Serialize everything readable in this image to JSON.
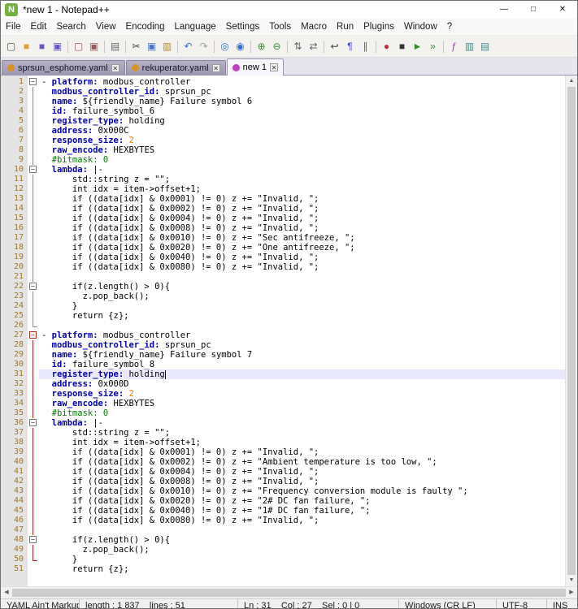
{
  "window": {
    "title": "*new 1 - Notepad++",
    "icon_glyph": "N",
    "minimize_glyph": "—",
    "maximize_glyph": "□",
    "close_glyph": "✕"
  },
  "menu": {
    "items": [
      "File",
      "Edit",
      "Search",
      "View",
      "Encoding",
      "Language",
      "Settings",
      "Tools",
      "Macro",
      "Run",
      "Plugins",
      "Window",
      "?"
    ]
  },
  "toolbar": {
    "icons": [
      {
        "name": "new-file",
        "glyph": "▢",
        "color": "#555555"
      },
      {
        "name": "open-folder",
        "glyph": "■",
        "color": "#e0a13c"
      },
      {
        "name": "save",
        "glyph": "■",
        "color": "#6457c8"
      },
      {
        "name": "save-all",
        "glyph": "▣",
        "color": "#6457c8"
      },
      {
        "sep": true
      },
      {
        "name": "close",
        "glyph": "▢",
        "color": "#9a5a5a"
      },
      {
        "name": "close-all",
        "glyph": "▣",
        "color": "#9a5a5a"
      },
      {
        "sep": true
      },
      {
        "name": "print",
        "glyph": "▤",
        "color": "#5f6a74"
      },
      {
        "sep": true
      },
      {
        "name": "cut",
        "glyph": "✂",
        "color": "#444444"
      },
      {
        "name": "copy",
        "glyph": "▣",
        "color": "#4a78c8"
      },
      {
        "name": "paste",
        "glyph": "▥",
        "color": "#b78a3a"
      },
      {
        "sep": true
      },
      {
        "name": "undo",
        "glyph": "↶",
        "color": "#2f6fd0"
      },
      {
        "name": "redo",
        "glyph": "↷",
        "color": "#98a0a8"
      },
      {
        "sep": true
      },
      {
        "name": "find",
        "glyph": "◎",
        "color": "#2f6fd0"
      },
      {
        "name": "replace",
        "glyph": "◉",
        "color": "#2f6fd0"
      },
      {
        "sep": true
      },
      {
        "name": "zoom-in",
        "glyph": "⊕",
        "color": "#2f8f2f"
      },
      {
        "name": "zoom-out",
        "glyph": "⊖",
        "color": "#2f8f2f"
      },
      {
        "sep": true
      },
      {
        "name": "sync-vertical",
        "glyph": "⇅",
        "color": "#5f6a74"
      },
      {
        "name": "sync-horizontal",
        "glyph": "⇄",
        "color": "#5f6a74"
      },
      {
        "sep": true
      },
      {
        "name": "word-wrap",
        "glyph": "↩",
        "color": "#444444"
      },
      {
        "name": "show-all-chars",
        "glyph": "¶",
        "color": "#3a3ad0"
      },
      {
        "name": "indent-guide",
        "glyph": "∥",
        "color": "#666666"
      },
      {
        "sep": true
      },
      {
        "name": "macro-record",
        "glyph": "●",
        "color": "#c23030"
      },
      {
        "name": "macro-stop",
        "glyph": "■",
        "color": "#333333"
      },
      {
        "name": "macro-play",
        "glyph": "►",
        "color": "#2f8f2f"
      },
      {
        "name": "macro-run-multiple",
        "glyph": "»",
        "color": "#2f8f2f"
      },
      {
        "sep": true
      },
      {
        "name": "function-list",
        "glyph": "ƒ",
        "color": "#8a4a9a"
      },
      {
        "name": "document-map",
        "glyph": "▥",
        "color": "#4a8a8a"
      },
      {
        "name": "document-list",
        "glyph": "▤",
        "color": "#4a8a8a"
      }
    ]
  },
  "tab_close_glyph": "✕",
  "tabs": [
    {
      "label": "sprsun_esphome.yaml",
      "active": false,
      "icon_color": "#d8922c"
    },
    {
      "label": "rekuperator.yaml",
      "active": false,
      "icon_color": "#d8922c"
    },
    {
      "label": "new 1",
      "active": true,
      "icon_color": "#bf3fbf"
    }
  ],
  "scrollbar": {
    "up": "▲",
    "down": "▼",
    "left": "◀",
    "right": "▶"
  },
  "editor": {
    "current_line": 31,
    "lines": [
      {
        "n": 1,
        "f": "box",
        "t": [
          [
            "t",
            "- "
          ],
          [
            "k",
            "platform:"
          ],
          [
            "t",
            " modbus_controller"
          ]
        ]
      },
      {
        "n": 2,
        "f": "vl",
        "t": [
          [
            "t",
            "  "
          ],
          [
            "k",
            "modbus_controller_id:"
          ],
          [
            "t",
            " sprsun_pc"
          ]
        ]
      },
      {
        "n": 3,
        "f": "vl",
        "t": [
          [
            "t",
            "  "
          ],
          [
            "k",
            "name:"
          ],
          [
            "t",
            " ${friendly_name} Failure symbol 6"
          ]
        ]
      },
      {
        "n": 4,
        "f": "vl",
        "t": [
          [
            "t",
            "  "
          ],
          [
            "k",
            "id:"
          ],
          [
            "t",
            " failure_symbol_6"
          ]
        ]
      },
      {
        "n": 5,
        "f": "vl",
        "t": [
          [
            "t",
            "  "
          ],
          [
            "k",
            "register_type:"
          ],
          [
            "t",
            " holding"
          ]
        ]
      },
      {
        "n": 6,
        "f": "vl",
        "t": [
          [
            "t",
            "  "
          ],
          [
            "k",
            "address:"
          ],
          [
            "t",
            " 0x000C"
          ]
        ]
      },
      {
        "n": 7,
        "f": "vl",
        "t": [
          [
            "t",
            "  "
          ],
          [
            "k",
            "response_size:"
          ],
          [
            "t",
            " "
          ],
          [
            "n",
            "2"
          ]
        ]
      },
      {
        "n": 8,
        "f": "vl",
        "t": [
          [
            "t",
            "  "
          ],
          [
            "k",
            "raw_encode:"
          ],
          [
            "t",
            " HEXBYTES"
          ]
        ]
      },
      {
        "n": 9,
        "f": "vl",
        "t": [
          [
            "c",
            "  #bitmask: 0"
          ]
        ]
      },
      {
        "n": 10,
        "f": "box",
        "t": [
          [
            "t",
            "  "
          ],
          [
            "k",
            "lambda:"
          ],
          [
            "t",
            " |-"
          ]
        ]
      },
      {
        "n": 11,
        "f": "vl",
        "t": [
          [
            "t",
            "      std::string z = \"\";"
          ]
        ]
      },
      {
        "n": 12,
        "f": "vl",
        "t": [
          [
            "t",
            "      int idx = item->offset+1;"
          ]
        ]
      },
      {
        "n": 13,
        "f": "vl",
        "t": [
          [
            "t",
            "      if ((data[idx] & 0x0001) != 0) z += \"Invalid, \";"
          ]
        ]
      },
      {
        "n": 14,
        "f": "vl",
        "t": [
          [
            "t",
            "      if ((data[idx] & 0x0002) != 0) z += \"Invalid, \";"
          ]
        ]
      },
      {
        "n": 15,
        "f": "vl",
        "t": [
          [
            "t",
            "      if ((data[idx] & 0x0004) != 0) z += \"Invalid, \";"
          ]
        ]
      },
      {
        "n": 16,
        "f": "vl",
        "t": [
          [
            "t",
            "      if ((data[idx] & 0x0008) != 0) z += \"Invalid, \";"
          ]
        ]
      },
      {
        "n": 17,
        "f": "vl",
        "t": [
          [
            "t",
            "      if ((data[idx] & 0x0010) != 0) z += \"Sec antifreeze, \";"
          ]
        ]
      },
      {
        "n": 18,
        "f": "vl",
        "t": [
          [
            "t",
            "      if ((data[idx] & 0x0020) != 0) z += \"One antifreeze, \";"
          ]
        ]
      },
      {
        "n": 19,
        "f": "vl",
        "t": [
          [
            "t",
            "      if ((data[idx] & 0x0040) != 0) z += \"Invalid, \";"
          ]
        ]
      },
      {
        "n": 20,
        "f": "vl",
        "t": [
          [
            "t",
            "      if ((data[idx] & 0x0080) != 0) z += \"Invalid, \";"
          ]
        ]
      },
      {
        "n": 21,
        "f": "vl",
        "t": []
      },
      {
        "n": 22,
        "f": "box",
        "t": [
          [
            "t",
            "      if(z.length() > 0){"
          ]
        ]
      },
      {
        "n": 23,
        "f": "vl",
        "t": [
          [
            "t",
            "        z.pop_back();"
          ]
        ]
      },
      {
        "n": 24,
        "f": "vl",
        "t": [
          [
            "t",
            "      }"
          ]
        ]
      },
      {
        "n": 25,
        "f": "vl",
        "t": [
          [
            "t",
            "      return {z};"
          ]
        ]
      },
      {
        "n": 26,
        "f": "end",
        "t": []
      },
      {
        "n": 27,
        "f": "box",
        "fc": "r",
        "t": [
          [
            "t",
            "- "
          ],
          [
            "k",
            "platform:"
          ],
          [
            "t",
            " modbus_controller"
          ]
        ]
      },
      {
        "n": 28,
        "f": "vl",
        "fc": "r",
        "t": [
          [
            "t",
            "  "
          ],
          [
            "k",
            "modbus_controller_id:"
          ],
          [
            "t",
            " sprsun_pc"
          ]
        ]
      },
      {
        "n": 29,
        "f": "vl",
        "fc": "r",
        "t": [
          [
            "t",
            "  "
          ],
          [
            "k",
            "name:"
          ],
          [
            "t",
            " ${friendly_name} Failure symbol 7"
          ]
        ]
      },
      {
        "n": 30,
        "f": "vl",
        "fc": "r",
        "t": [
          [
            "t",
            "  "
          ],
          [
            "k",
            "id:"
          ],
          [
            "t",
            " failure_symbol_8"
          ]
        ]
      },
      {
        "n": 31,
        "f": "vl",
        "fc": "r",
        "cur": true,
        "caret": true,
        "t": [
          [
            "t",
            "  "
          ],
          [
            "k",
            "register_type:"
          ],
          [
            "t",
            " holding"
          ]
        ]
      },
      {
        "n": 32,
        "f": "vl",
        "fc": "r",
        "t": [
          [
            "t",
            "  "
          ],
          [
            "k",
            "address:"
          ],
          [
            "t",
            " 0x000D"
          ]
        ]
      },
      {
        "n": 33,
        "f": "vl",
        "fc": "r",
        "t": [
          [
            "t",
            "  "
          ],
          [
            "k",
            "response_size:"
          ],
          [
            "t",
            " "
          ],
          [
            "n",
            "2"
          ]
        ]
      },
      {
        "n": 34,
        "f": "vl",
        "fc": "r",
        "t": [
          [
            "t",
            "  "
          ],
          [
            "k",
            "raw_encode:"
          ],
          [
            "t",
            " HEXBYTES"
          ]
        ]
      },
      {
        "n": 35,
        "f": "vl",
        "fc": "r",
        "t": [
          [
            "c",
            "  #bitmask: 0"
          ]
        ]
      },
      {
        "n": 36,
        "f": "box",
        "t": [
          [
            "t",
            "  "
          ],
          [
            "k",
            "lambda:"
          ],
          [
            "t",
            " |-"
          ]
        ]
      },
      {
        "n": 37,
        "f": "vl",
        "fc": "r",
        "t": [
          [
            "t",
            "      std::string z = \"\";"
          ]
        ]
      },
      {
        "n": 38,
        "f": "vl",
        "fc": "r",
        "t": [
          [
            "t",
            "      int idx = item->offset+1;"
          ]
        ]
      },
      {
        "n": 39,
        "f": "vl",
        "fc": "r",
        "t": [
          [
            "t",
            "      if ((data[idx] & 0x0001) != 0) z += \"Invalid, \";"
          ]
        ]
      },
      {
        "n": 40,
        "f": "vl",
        "fc": "r",
        "t": [
          [
            "t",
            "      if ((data[idx] & 0x0002) != 0) z += \"Ambient temperature is too low, \";"
          ]
        ]
      },
      {
        "n": 41,
        "f": "vl",
        "fc": "r",
        "t": [
          [
            "t",
            "      if ((data[idx] & 0x0004) != 0) z += \"Invalid, \";"
          ]
        ]
      },
      {
        "n": 42,
        "f": "vl",
        "fc": "r",
        "t": [
          [
            "t",
            "      if ((data[idx] & 0x0008) != 0) z += \"Invalid, \";"
          ]
        ]
      },
      {
        "n": 43,
        "f": "vl",
        "fc": "r",
        "t": [
          [
            "t",
            "      if ((data[idx] & 0x0010) != 0) z += \"Frequency conversion module is faulty \";"
          ]
        ]
      },
      {
        "n": 44,
        "f": "vl",
        "fc": "r",
        "t": [
          [
            "t",
            "      if ((data[idx] & 0x0020) != 0) z += \"2# DC fan failure, \";"
          ]
        ]
      },
      {
        "n": 45,
        "f": "vl",
        "fc": "r",
        "t": [
          [
            "t",
            "      if ((data[idx] & 0x0040) != 0) z += \"1# DC fan failure, \";"
          ]
        ]
      },
      {
        "n": 46,
        "f": "vl",
        "fc": "r",
        "t": [
          [
            "t",
            "      if ((data[idx] & 0x0080) != 0) z += \"Invalid, \";"
          ]
        ]
      },
      {
        "n": 47,
        "f": "vl",
        "fc": "r",
        "t": []
      },
      {
        "n": 48,
        "f": "box",
        "t": [
          [
            "t",
            "      if(z.length() > 0){"
          ]
        ]
      },
      {
        "n": 49,
        "f": "vl",
        "fc": "r",
        "t": [
          [
            "t",
            "        z.pop_back();"
          ]
        ]
      },
      {
        "n": 50,
        "f": "end",
        "fc": "r",
        "t": [
          [
            "t",
            "      }"
          ]
        ]
      },
      {
        "n": 51,
        "t": [
          [
            "t",
            "      return {z};"
          ]
        ]
      }
    ]
  },
  "status_bar": {
    "doc_type": "YAML Ain't Markup Language",
    "length_info": "length : 1 837    lines : 51",
    "position_info": "Ln : 31    Col : 27    Sel : 0 | 0",
    "eol": "Windows (CR LF)",
    "encoding": "UTF-8",
    "mode": "INS"
  }
}
